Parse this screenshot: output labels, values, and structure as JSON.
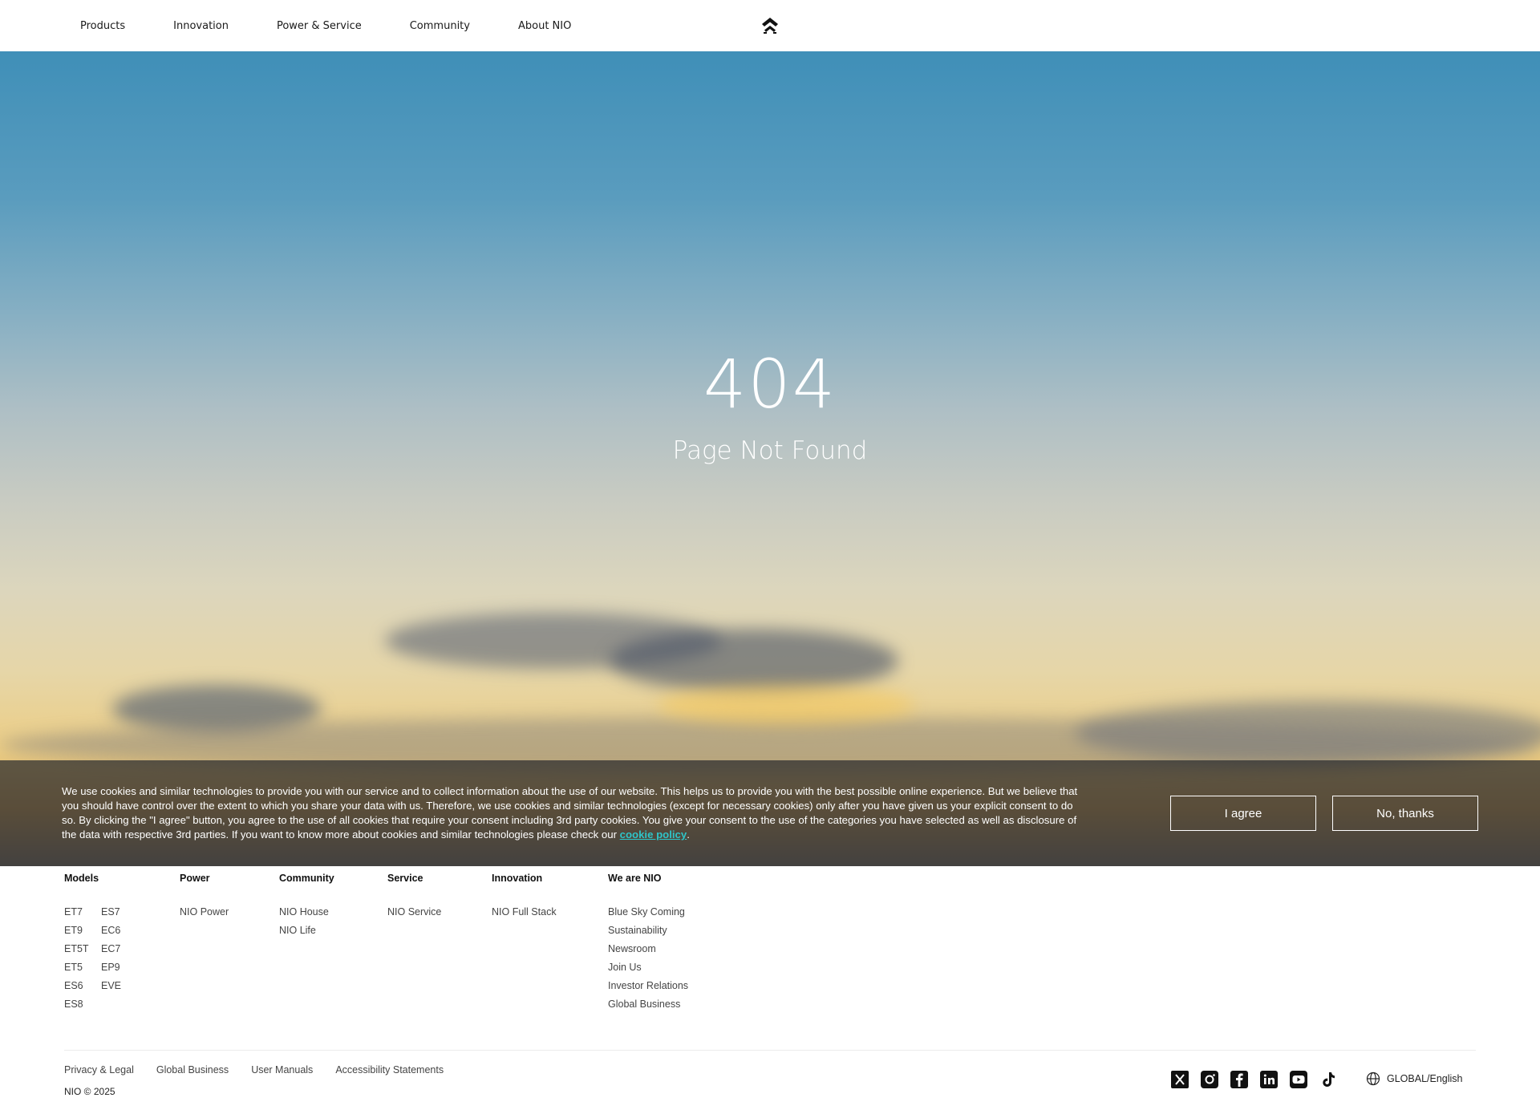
{
  "header": {
    "nav": [
      "Products",
      "Innovation",
      "Power & Service",
      "Community",
      "About NIO"
    ],
    "logo_icon": "nio-logo-icon"
  },
  "hero": {
    "code": "404",
    "message": "Page Not Found"
  },
  "cookie": {
    "text": "We use cookies and similar technologies to provide you with our service and to collect information about the use of our website. This helps us to provide you with the best possible online experience. But we believe that you should have control over the extent to which you share your data with us. Therefore, we use cookies and similar technologies (except for necessary cookies) only after you have given us your explicit consent to do so. By clicking the \"I agree\" button, you agree to the use of all cookies that require your consent including 3rd party cookies. You give your consent to the use of the categories you have selected as well as disclosure of the data with respective 3rd parties. If you want to know more about cookies and similar technologies please check our ",
    "link": "cookie policy",
    "period": ".",
    "agree": "I agree",
    "decline": "No, thanks",
    "link_color": "#2ec5c9"
  },
  "footer": {
    "columns": [
      {
        "title": "Models",
        "links": [
          "ET7",
          "ES7",
          "ET9",
          "EC6",
          "ET5T",
          "EC7",
          "ET5",
          "EP9",
          "ES6",
          "EVE",
          "ES8"
        ]
      },
      {
        "title": "Power",
        "links": [
          "NIO Power"
        ]
      },
      {
        "title": "Community",
        "links": [
          "NIO House",
          "NIO Life"
        ]
      },
      {
        "title": "Service",
        "links": [
          "NIO Service"
        ]
      },
      {
        "title": "Innovation",
        "links": [
          "NIO Full Stack"
        ]
      },
      {
        "title": "We are NIO",
        "links": [
          "Blue Sky Coming",
          "Sustainability",
          "Newsroom",
          "Join Us",
          "Investor Relations",
          "Global Business"
        ]
      }
    ],
    "legal": [
      "Privacy & Legal",
      "Global Business",
      "User Manuals",
      "Accessibility Statements"
    ],
    "copyright": "NIO © 2025",
    "social": [
      "x-icon",
      "instagram-icon",
      "facebook-icon",
      "linkedin-icon",
      "youtube-icon",
      "tiktok-icon"
    ],
    "language": "GLOBAL/English"
  }
}
